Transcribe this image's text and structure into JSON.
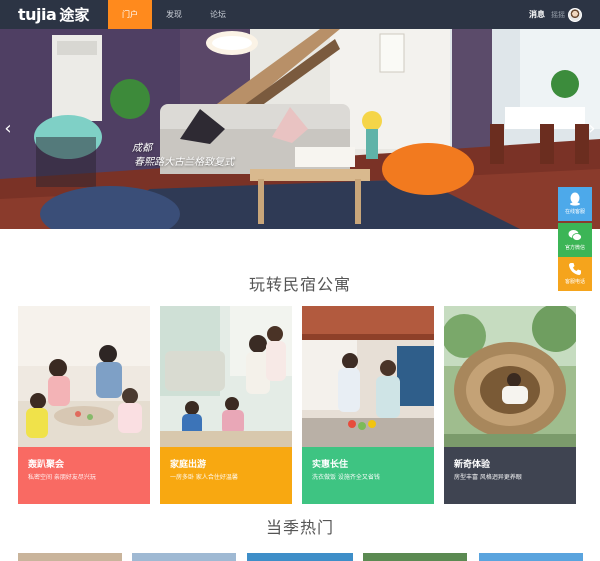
{
  "header": {
    "logo_mark": "tujia",
    "logo_name": "途家",
    "nav": [
      {
        "label": "门户",
        "active": true
      },
      {
        "label": "发现",
        "active": false
      },
      {
        "label": "论坛",
        "active": false
      }
    ],
    "messages_label": "消息",
    "username": "摇摇"
  },
  "hero": {
    "caption_line1": "成都",
    "caption_line2": "春熙路大古兰格致复式",
    "prev_arrow": "‹",
    "next_arrow": "›"
  },
  "side_buttons": [
    {
      "label": "在线客服",
      "icon": "qq-icon"
    },
    {
      "label": "官方微信",
      "icon": "wechat-icon"
    },
    {
      "label": "客服电话",
      "icon": "phone-icon"
    }
  ],
  "section_titles": {
    "main": "玩转民宿公寓",
    "seasonal": "当季热门"
  },
  "cards": [
    {
      "title": "轰趴聚会",
      "subtitle": "私密空间 亲朋好友尽兴玩"
    },
    {
      "title": "家庭出游",
      "subtitle": "一房多卧 家人合住好温馨"
    },
    {
      "title": "实惠长住",
      "subtitle": "洗衣做饭 设施齐全又省钱"
    },
    {
      "title": "新奇体验",
      "subtitle": "房型丰富 风格迥异更养眼"
    }
  ],
  "colors": {
    "topbar": "#2c3444",
    "nav_active": "#ff8a1d",
    "card_party": "#f96a63",
    "card_family": "#f8a811",
    "card_longstay": "#3ec482",
    "card_novel": "#3f4451"
  }
}
